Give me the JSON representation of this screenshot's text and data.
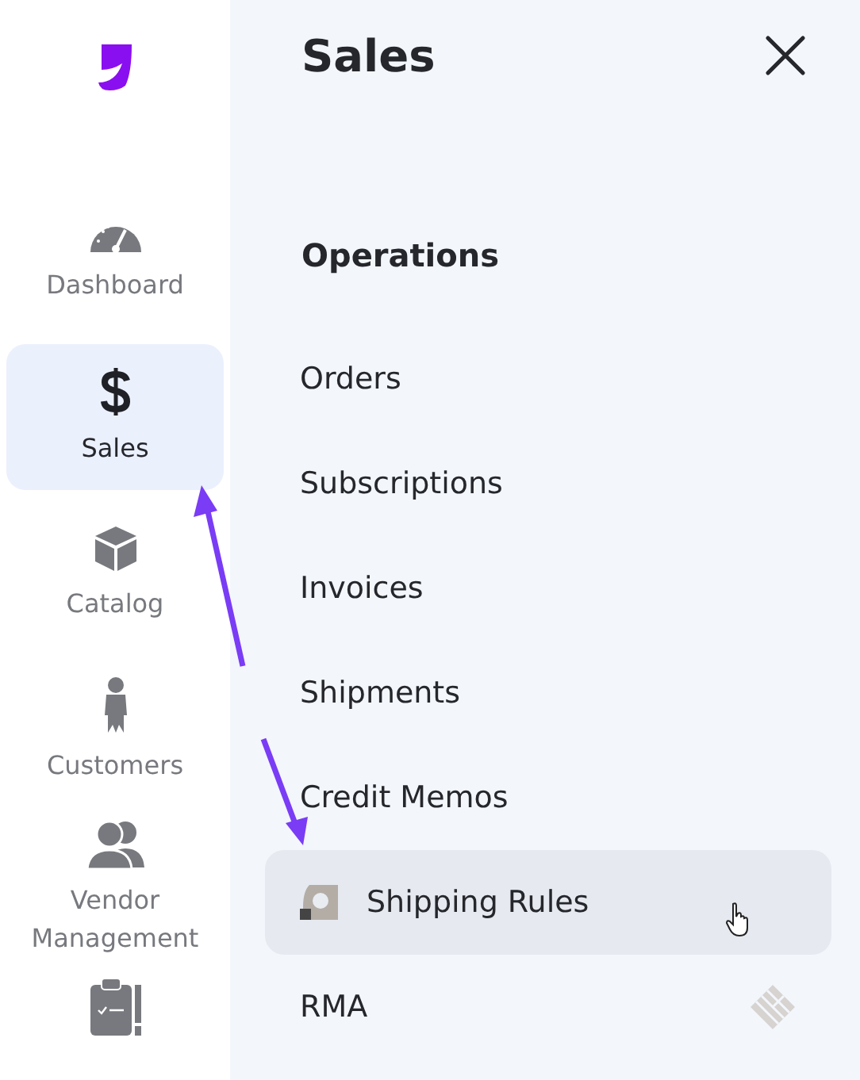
{
  "sidebar": {
    "items": [
      {
        "label": "Dashboard",
        "selected": false
      },
      {
        "label": "Sales",
        "selected": true
      },
      {
        "label": "Catalog",
        "selected": false
      },
      {
        "label": "Customers",
        "selected": false
      },
      {
        "label": [
          "Vendor",
          "Management"
        ],
        "selected": false
      }
    ]
  },
  "panel": {
    "title": "Sales",
    "section": "Operations",
    "items": [
      {
        "label": "Orders",
        "kind": "plain",
        "highlighted": false
      },
      {
        "label": "Subscriptions",
        "kind": "plain",
        "highlighted": false
      },
      {
        "label": "Invoices",
        "kind": "plain",
        "highlighted": false
      },
      {
        "label": "Shipments",
        "kind": "plain",
        "highlighted": false
      },
      {
        "label": "Credit Memos",
        "kind": "plain",
        "highlighted": false
      },
      {
        "label": "Shipping Rules",
        "kind": "leading-icon",
        "highlighted": true
      },
      {
        "label": "RMA",
        "kind": "trailing-icon",
        "highlighted": false
      }
    ]
  }
}
